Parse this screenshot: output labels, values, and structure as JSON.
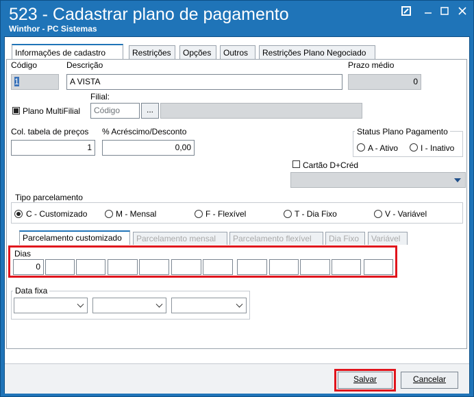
{
  "window": {
    "title": "523 - Cadastrar plano de pagamento",
    "subtitle": "Winthor - PC Sistemas"
  },
  "tabs": [
    {
      "label": "Informações de cadastro",
      "active": true
    },
    {
      "label": "Restrições"
    },
    {
      "label": "Opções"
    },
    {
      "label": "Outros"
    },
    {
      "label": "Restrições Plano Negociado"
    }
  ],
  "form": {
    "codigo_label": "Código",
    "codigo_value": "1",
    "descricao_label": "Descrição",
    "descricao_value": "A VISTA",
    "prazo_label": "Prazo médio",
    "prazo_value": "0",
    "filial_label": "Filial:",
    "multifilial_label": "Plano MultiFilial",
    "filial_placeholder": "Código",
    "filial_btn": "...",
    "col_tabela_label": "Col. tabela de preços",
    "col_tabela_value": "1",
    "acrescimo_label": "% Acréscimo/Desconto",
    "acrescimo_value": "0,00",
    "status_title": "Status Plano Pagamento",
    "status_ativo": "A - Ativo",
    "status_inativo": "I - Inativo",
    "cartao_label": "Cartão D+Créd"
  },
  "tipo_parcelamento": {
    "title": "Tipo parcelamento",
    "options": [
      "C - Customizado",
      "M - Mensal",
      "F - Flexível",
      "T - Dia Fixo",
      "V - Variável"
    ],
    "selected": "C - Customizado"
  },
  "subtabs": [
    {
      "label": "Parcelamento customizado",
      "active": true
    },
    {
      "label": "Parcelamento mensal",
      "disabled": true
    },
    {
      "label": "Parcelamento flexível",
      "disabled": true
    },
    {
      "label": "Dia Fixo",
      "disabled": true
    },
    {
      "label": "Variável",
      "disabled": true
    }
  ],
  "dias": {
    "title": "Dias",
    "values": [
      "0",
      "",
      "",
      "",
      "",
      "",
      "",
      "",
      "",
      "",
      "",
      ""
    ]
  },
  "data_fixa": {
    "title": "Data fixa"
  },
  "buttons": {
    "salvar": "Salvar",
    "cancelar": "Cancelar"
  },
  "colors": {
    "titlebar": "#1f74b8",
    "highlight": "#e0141c"
  }
}
